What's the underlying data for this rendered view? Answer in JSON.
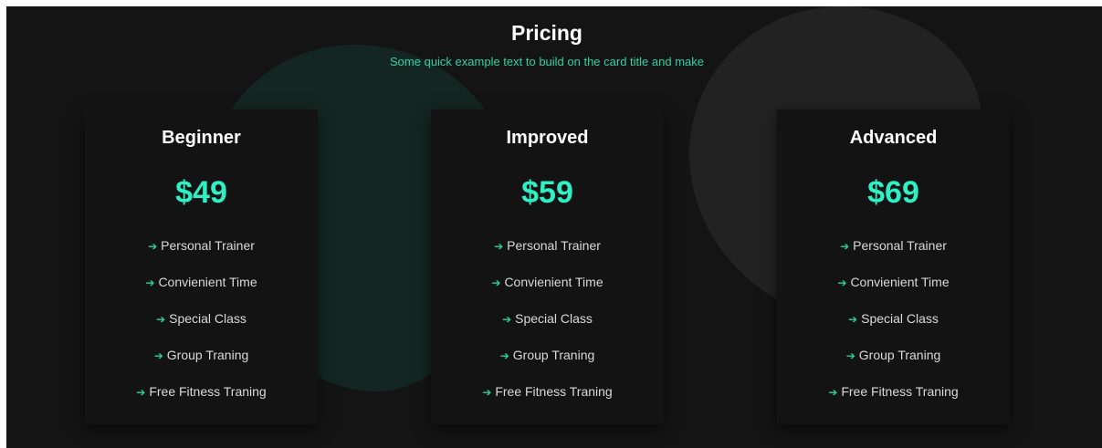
{
  "pricing": {
    "title": "Pricing",
    "subtitle": "Some quick example text to build on the card title and make"
  },
  "plans": [
    {
      "name": "Beginner",
      "price": "$49",
      "features": [
        "Personal Trainer",
        "Convienient Time",
        "Special Class",
        "Group Traning",
        "Free Fitness Traning"
      ]
    },
    {
      "name": "Improved",
      "price": "$59",
      "features": [
        "Personal Trainer",
        "Convienient Time",
        "Special Class",
        "Group Traning",
        "Free Fitness Traning"
      ]
    },
    {
      "name": "Advanced",
      "price": "$69",
      "features": [
        "Personal Trainer",
        "Convienient Time",
        "Special Class",
        "Group Traning",
        "Free Fitness Traning"
      ]
    }
  ],
  "icons": {
    "feature_bullet": "arrow-right-icon"
  },
  "colors": {
    "background": "#141414",
    "card": "#131313",
    "accent": "#2ef0c4",
    "subtitle": "#2fd3a5",
    "blob_green": "#142621",
    "blob_gray": "#222222"
  }
}
